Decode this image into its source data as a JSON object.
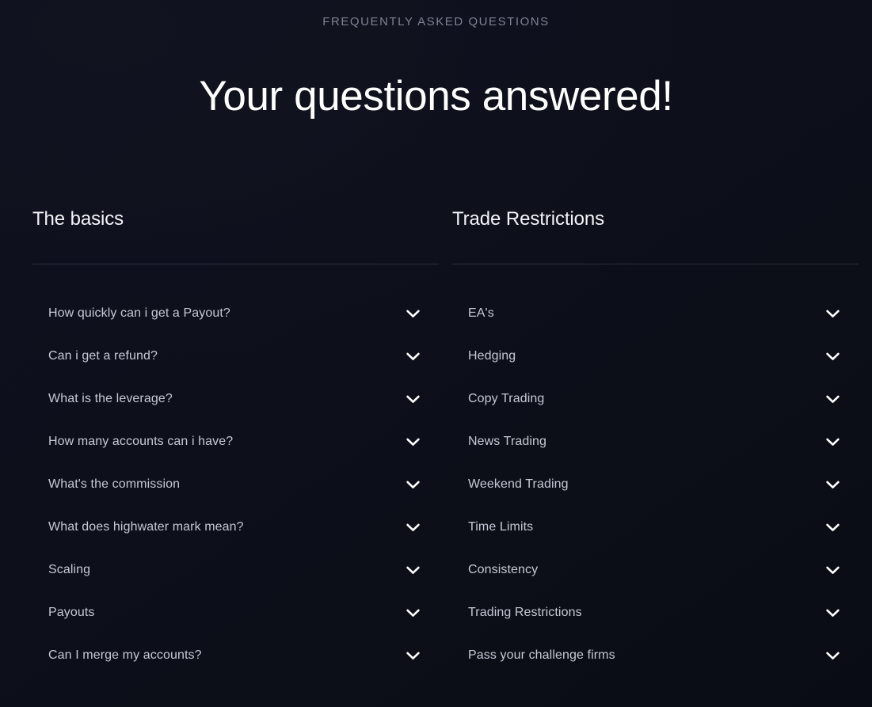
{
  "header": {
    "eyebrow": "FREQUENTLY ASKED QUESTIONS",
    "headline": "Your questions answered!"
  },
  "colors": {
    "background": "#0d0f1a",
    "eyebrow_text": "#7d8292",
    "headline_text": "#ffffff",
    "column_title_text": "#f3f4f8",
    "question_text": "#c6c9d5",
    "divider": "#2b2f3e",
    "chevron": "#ffffff"
  },
  "icons": {
    "chevron": "chevron-down-icon"
  },
  "columns": [
    {
      "id": "the-basics",
      "title": "The basics",
      "items": [
        {
          "label": "How quickly can i get a Payout?"
        },
        {
          "label": "Can i get a refund?"
        },
        {
          "label": "What is the leverage?"
        },
        {
          "label": "How many accounts can i have?"
        },
        {
          "label": "What's the commission"
        },
        {
          "label": "What does highwater mark mean?"
        },
        {
          "label": "Scaling"
        },
        {
          "label": "Payouts"
        },
        {
          "label": "Can I merge my accounts?"
        }
      ]
    },
    {
      "id": "trade-restrictions",
      "title": "Trade Restrictions",
      "items": [
        {
          "label": "EA's"
        },
        {
          "label": "Hedging"
        },
        {
          "label": "Copy Trading"
        },
        {
          "label": "News Trading"
        },
        {
          "label": "Weekend Trading"
        },
        {
          "label": "Time Limits"
        },
        {
          "label": "Consistency"
        },
        {
          "label": "Trading Restrictions"
        },
        {
          "label": "Pass your challenge firms"
        }
      ]
    }
  ]
}
